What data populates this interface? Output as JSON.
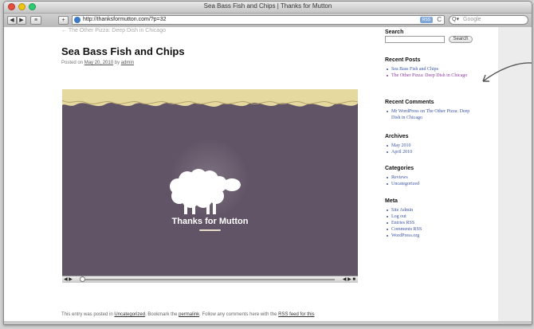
{
  "window": {
    "title": "Sea Bass Fish and Chips | Thanks for Mutton"
  },
  "toolbar": {
    "back_icon": "back-icon",
    "forward_icon": "forward-icon",
    "bookmarks_label": "≡",
    "add_label": "+",
    "url": "http://thanksformutton.com/?p=32",
    "rss_label": "RSS",
    "reload_label": "C",
    "search_placeholder": "Google",
    "search_icon_label": "Q▾"
  },
  "post": {
    "prev_link": "← The Other Pizza: Deep Dish in Chicago",
    "title": "Sea Bass Fish and Chips",
    "meta_prefix": "Posted on",
    "date": "May 20, 2010",
    "meta_by": "by",
    "author": "admin",
    "video_title": "Thanks for Mutton",
    "footer_prefix": "This entry was posted in",
    "footer_category": "Uncategorized",
    "footer_mid": ". Bookmark the",
    "footer_permalink": "permalink",
    "footer_mid2": ". Follow any comments here with the",
    "footer_rss": "RSS feed for this"
  },
  "video_controls": {
    "play_icon": "◀ ▶",
    "right_icon": "◀ ▶ ■"
  },
  "sidebar": {
    "search_heading": "Search",
    "search_button": "Search",
    "recent_posts_heading": "Recent Posts",
    "recent_posts": [
      "Sea Bass Fish and Chips",
      "The Other Pizza: Deep Dish in Chicago"
    ],
    "recent_comments_heading": "Recent Comments",
    "recent_comments": [
      "Mr WordPress on The Other Pizza: Deep Dish in Chicago"
    ],
    "archives_heading": "Archives",
    "archives": [
      "May 2010",
      "April 2010"
    ],
    "categories_heading": "Categories",
    "categories": [
      "Reviews",
      "Uncategorized"
    ],
    "meta_heading": "Meta",
    "meta": [
      "Site Admin",
      "Log out",
      "Entries RSS",
      "Comments RSS",
      "WordPress.org"
    ]
  },
  "colors": {
    "video_bg": "#615466",
    "clouds": "#e6d9a0",
    "link": "#3a55a6",
    "visited": "#8a3b9e"
  }
}
